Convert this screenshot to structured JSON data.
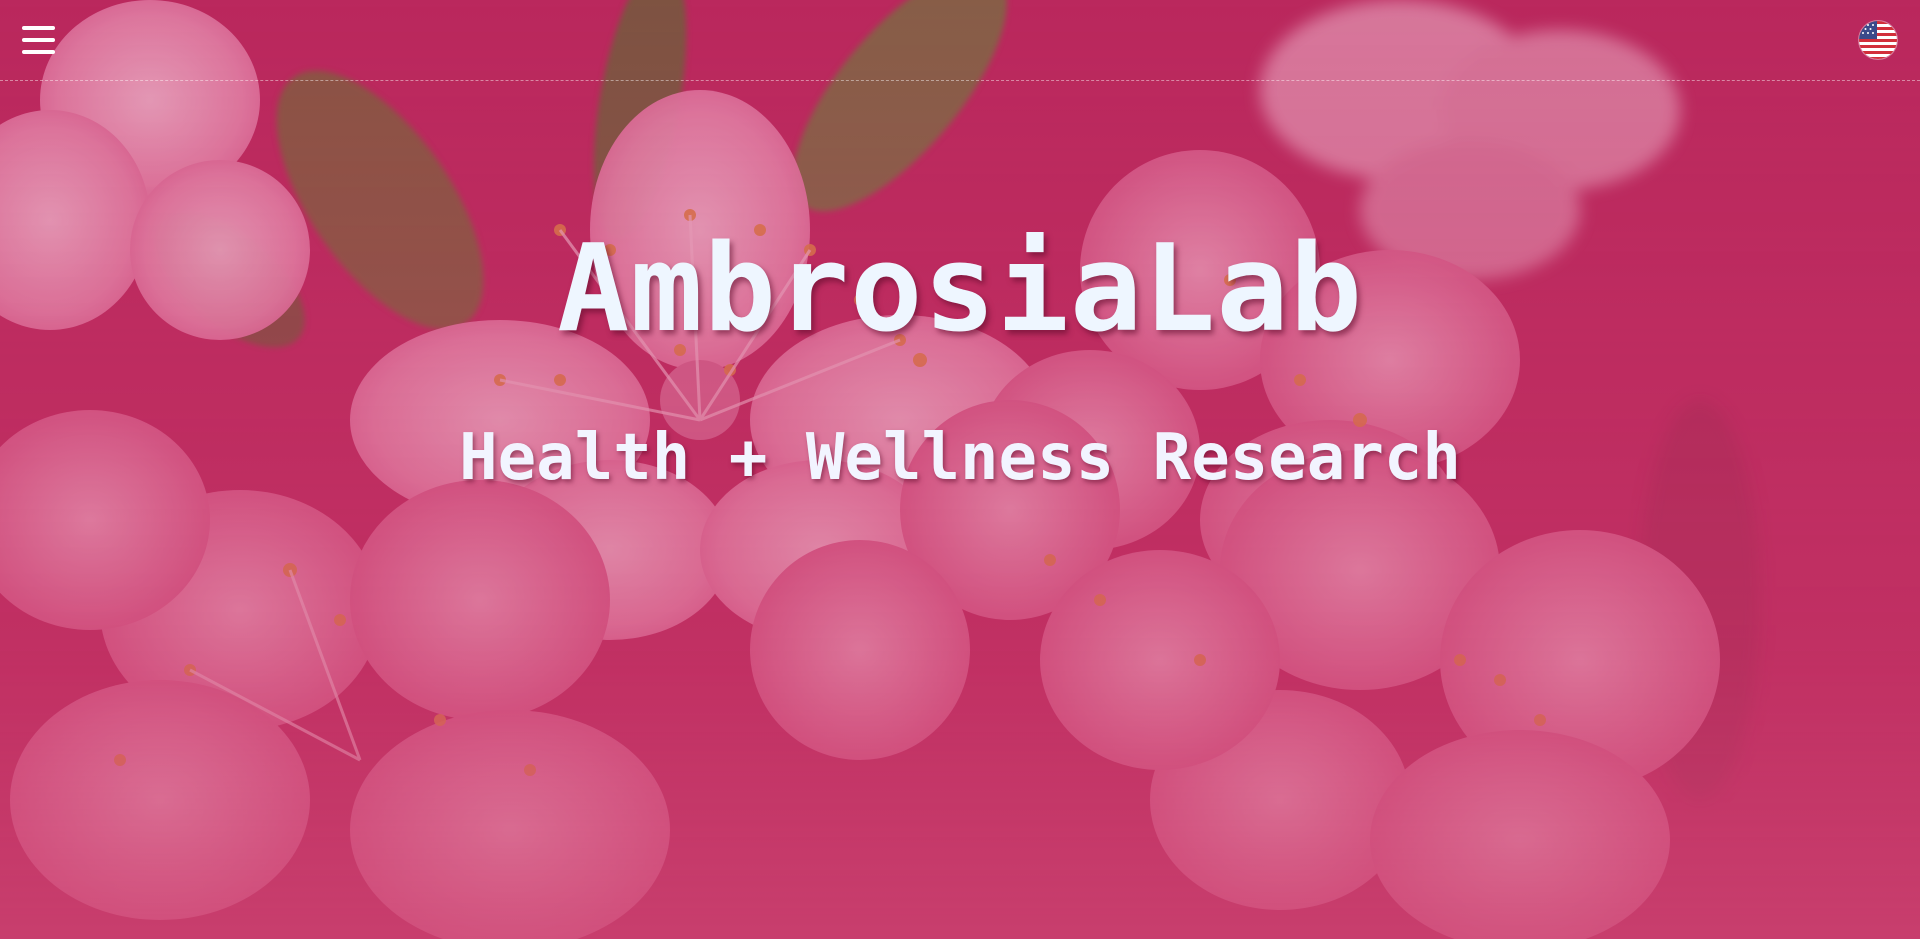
{
  "site": {
    "title": "AmbrosiaLab",
    "subtitle": "Health + Wellness Research"
  },
  "nav": {
    "menu_icon": "hamburger-menu-icon",
    "language_icon": "us-flag-icon"
  },
  "colors": {
    "background_pink": "#b8285c",
    "petal_pink": "#f2a6c4",
    "title_text": "#eef6ff",
    "stamen_orange": "#e39a3a",
    "leaf_green": "#6b7a3a"
  }
}
